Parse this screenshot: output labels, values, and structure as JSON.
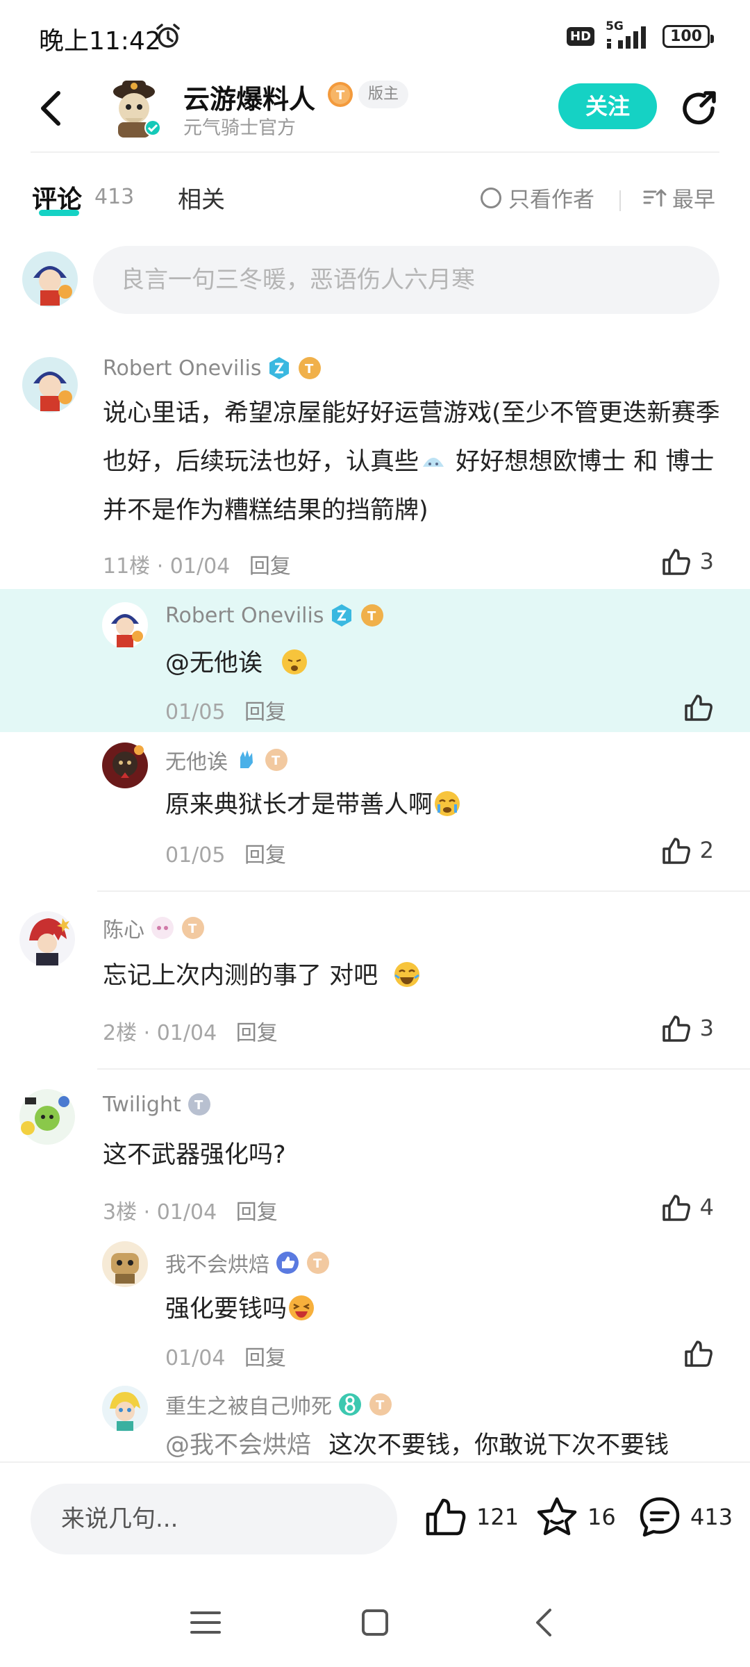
{
  "status_bar": {
    "time": "晚上11:42",
    "hd": "HD",
    "network": "5G",
    "battery": "100"
  },
  "header": {
    "author_name": "云游爆料人",
    "author_level": "T9",
    "role_tag": "版主",
    "subtitle": "元气骑士官方",
    "follow_label": "关注"
  },
  "tabs": {
    "comments_label": "评论",
    "comments_count": "413",
    "related_label": "相关",
    "author_only_label": "只看作者",
    "sort_label": "最早"
  },
  "comment_input": {
    "placeholder": "良言一句三冬暖，恶语伤人六月寒"
  },
  "comments": [
    {
      "user": "Robert Onevilis",
      "level": "T1",
      "text": "说心里话，希望凉屋能好好运营游戏(至少不管更迭新赛季也好，后续玩法也好，认真些",
      "text2": "好好想想欧博士 和 博士 并不是作为糟糕结果的挡箭牌)",
      "floor": "11楼",
      "date": "01/04",
      "reply": "回复",
      "likes": "3",
      "replies": [
        {
          "user": "Robert Onevilis",
          "level": "T1",
          "text": "@无他诶",
          "date": "01/05",
          "reply": "回复",
          "likes": ""
        },
        {
          "user": "无他诶",
          "level": "T5",
          "text": "原来典狱长才是带善人啊",
          "date": "01/05",
          "reply": "回复",
          "likes": "2"
        }
      ]
    },
    {
      "user": "陈心",
      "level": "T4",
      "text": "忘记上次内测的事了 对吧",
      "floor": "2楼",
      "date": "01/04",
      "reply": "回复",
      "likes": "3"
    },
    {
      "user": "Twilight",
      "level": "T2",
      "text": "这不武器强化吗?",
      "floor": "3楼",
      "date": "01/04",
      "reply": "回复",
      "likes": "4",
      "replies": [
        {
          "user": "我不会烘焙",
          "level": "T5",
          "text": "强化要钱吗",
          "date": "01/04",
          "reply": "回复",
          "likes": ""
        },
        {
          "user": "重生之被自己帅死",
          "level": "T5",
          "mention": "@我不会烘焙",
          "text": "这次不要钱，你敢说下次不要钱"
        }
      ]
    }
  ],
  "separator": " · ",
  "bottom_bar": {
    "input_placeholder": "来说几句...",
    "likes": "121",
    "favorites": "16",
    "comments": "413"
  },
  "colors": {
    "accent": "#15d2c4",
    "highlight": "#e3f8f6",
    "level_gold": "#f0b04a",
    "level_silver": "#b8c0d0"
  }
}
